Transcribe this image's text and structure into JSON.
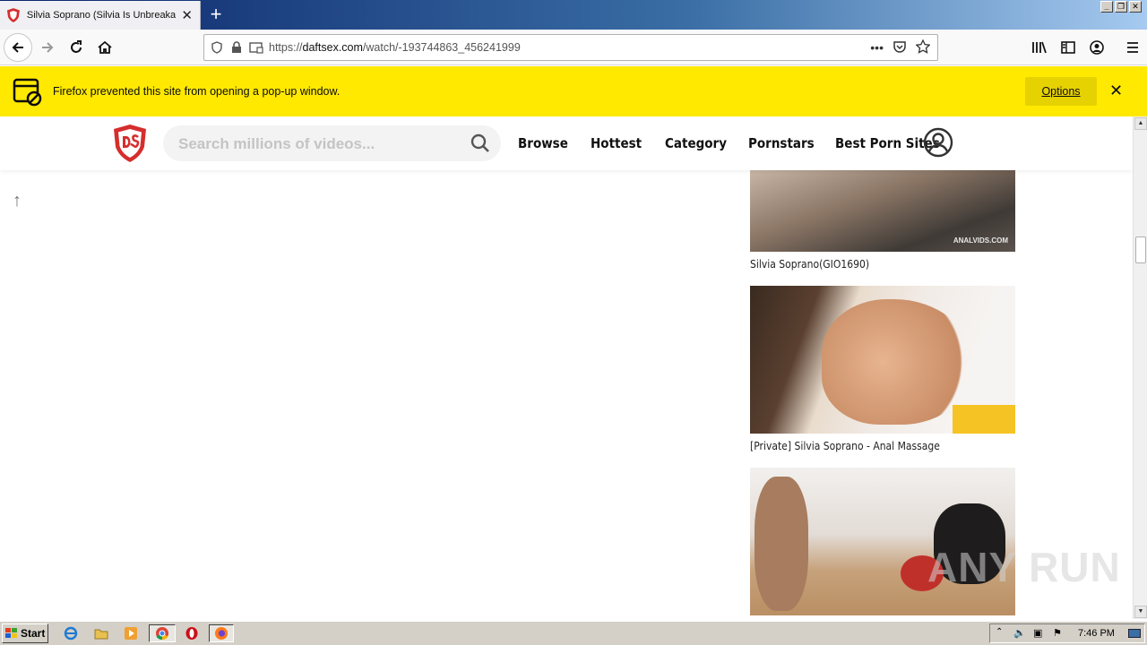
{
  "browser": {
    "tab": {
      "title": "Silvia Soprano (Silvia Is Unbreakab",
      "close": "✕"
    },
    "new_tab": "+",
    "url": {
      "prefix": "https://",
      "domain": "daftsex.com",
      "path": "/watch/-193744863_456241999"
    },
    "page_actions": "•••"
  },
  "popup_notice": {
    "message": "Firefox prevented this site from opening a pop-up window.",
    "options_label": "Options",
    "close": "✕",
    "bg_color": "#ffe900"
  },
  "site": {
    "search_placeholder": "Search millions of videos...",
    "menu": {
      "browse": "Browse",
      "hottest": "Hottest",
      "category": "Category",
      "pornstars": "Pornstars",
      "best": "Best Porn Sites"
    },
    "back_to_top": "↑",
    "accent_color": "#d62d2d"
  },
  "videos": [
    {
      "title": "Silvia Soprano(GIO1690)",
      "watermark": "ANALVIDS.COM"
    },
    {
      "title": "[Private] Silvia Soprano - Anal Massage"
    },
    {
      "title": ""
    }
  ],
  "overlay_watermark": "ANY RUN",
  "taskbar": {
    "start": "Start",
    "clock": "7:46 PM"
  }
}
